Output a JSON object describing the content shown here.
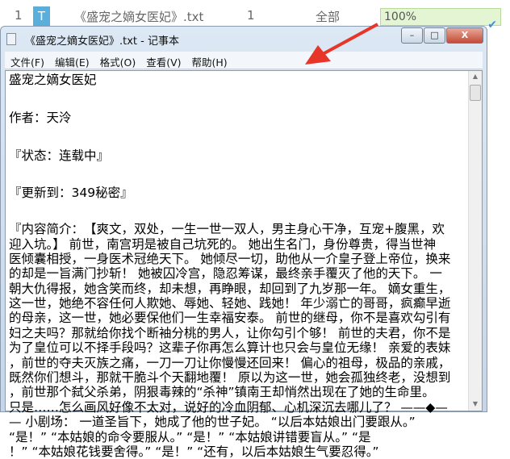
{
  "task_row": {
    "index": "1",
    "type_icon": "T",
    "filename": "《盛宠之嫡女医妃》.txt",
    "count": "1",
    "scope": "全部",
    "progress_label": "100%",
    "progress": 100
  },
  "window": {
    "title": "《盛宠之嫡女医妃》.txt - 记事本",
    "minimize": "–",
    "maximize": "□",
    "close": "X"
  },
  "menu": [
    "文件(F)",
    "编辑(E)",
    "格式(O)",
    "查看(V)",
    "帮助(H)"
  ],
  "header_lines": [
    "盛宠之嫡女医妃",
    "",
    "作者：天泠",
    "",
    "『状态：连载中』",
    "",
    "『更新到：349秘密』",
    ""
  ],
  "body_lines": [
    "『内容简介：　【爽文，双处，一生一世一双人，男主身心干净，互宠+腹黑，欢",
    "迎入坑。】 前世，南宫玥是被自己坑死的。 她出生名门，身份尊贵，得当世神",
    "医倾囊相授，一身医术冠绝天下。 她倾尽一切，助他从一介皇子登上帝位，换来",
    "的却是一旨满门抄斩！ 她被囚冷宫，隐忍筹谋，最终亲手覆灭了他的天下。 一",
    "朝大仇得报，她含笑而终，却未想，再睁眼，却回到了九岁那一年。 嫡女重生，",
    "这一世，她绝不容任何人欺她、辱她、轻她、践她！ 年少溺亡的哥哥，疯癫早逝",
    "的母亲，这一世，她必要保他们一生幸福安泰。 前世的继母，你不是喜欢勾引有",
    "妇之夫吗？那就给你找个断袖分桃的男人，让你勾引个够！ 前世的夫君，你不是",
    "为了皇位可以不择手段吗？这辈子你再怎么算计也只会与皇位无缘！ 亲爱的表妹",
    "，前世的夺夫灭族之痛，一刀一刀让你慢慢还回来！ 偏心的祖母，极品的亲戚，",
    "既然你们想斗，那就干脆斗个天翻地覆！ 原以为这一世，她会孤独终老，没想到",
    "，前世那个弑父杀弟，阴狠毒辣的“杀神”镇南王却悄然出现在了她的生命里。",
    "只是……怎么画风好像不太对，说好的冷血阴郁、心机深沉去哪儿了？ ——◆—",
    "— 小剧场： 一道圣旨下，她成了他的世子妃。 “以后本姑娘出门要跟从。”",
    "“是！” “本姑娘的命令要服从。” “是！” “本姑娘讲错要盲从。” “是",
    "！” “本姑娘花钱要舍得。” “是！” “还有，以后本姑娘生气要忍得。”"
  ],
  "colors": {
    "accent": "#5aaedc",
    "progress_bg": "#e4f5d3",
    "arrow": "#e8352a"
  }
}
